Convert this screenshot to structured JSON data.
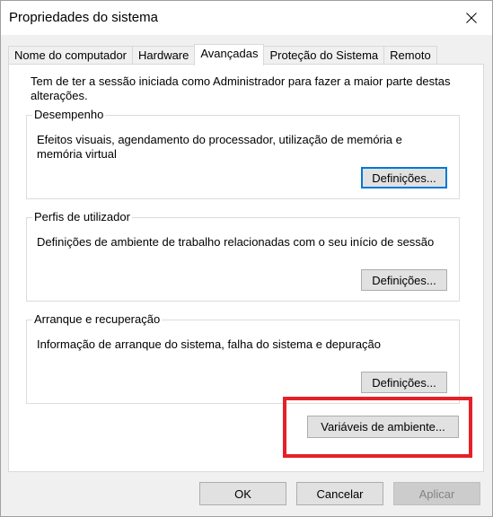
{
  "window": {
    "title": "Propriedades do sistema"
  },
  "icons": {
    "close": "close-icon"
  },
  "tabs": [
    {
      "label": "Nome do computador",
      "active": false
    },
    {
      "label": "Hardware",
      "active": false
    },
    {
      "label": "Avançadas",
      "active": true
    },
    {
      "label": "Proteção do Sistema",
      "active": false
    },
    {
      "label": "Remoto",
      "active": false
    }
  ],
  "intro_text": "Tem de ter a sessão iniciada como Administrador para fazer a maior parte destas alterações.",
  "groups": {
    "performance": {
      "title": "Desempenho",
      "description": "Efeitos visuais, agendamento do processador, utilização de memória e memória virtual",
      "button": "Definições..."
    },
    "user_profiles": {
      "title": "Perfis de utilizador",
      "description": "Definições de ambiente de trabalho relacionadas com o seu início de sessão",
      "button": "Definições..."
    },
    "startup_recovery": {
      "title": "Arranque e recuperação",
      "description": "Informação de arranque do sistema, falha do sistema e depuração",
      "button": "Definições..."
    }
  },
  "env_button": "Variáveis de ambiente...",
  "footer": {
    "ok": "OK",
    "cancel": "Cancelar",
    "apply": "Aplicar"
  },
  "colors": {
    "highlight": "#e52028",
    "focus": "#0078d7"
  }
}
